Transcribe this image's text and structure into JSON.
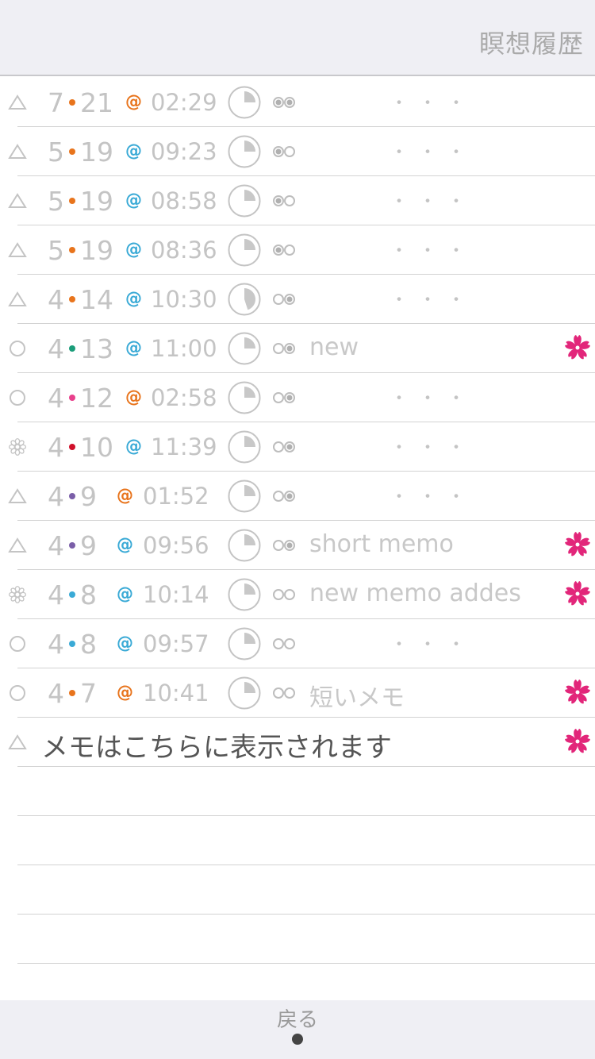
{
  "header": {
    "title": "瞑想履歴"
  },
  "colors": {
    "orange": "#e8741c",
    "blue": "#3aaad6",
    "green": "#1b9d7a",
    "pink": "#e8408c",
    "red": "#d0102a",
    "purple": "#7a5ea8",
    "flower": "#e2267a"
  },
  "records": [
    {
      "status_icon": "triangle-icon",
      "month": "7",
      "day": "21",
      "dot_color": "#e8741c",
      "at_color": "#e8741c",
      "time": "02:29",
      "progress": 0.25,
      "glasses_icon": "glasses-both-filled-icon",
      "memo": "",
      "flower": false
    },
    {
      "status_icon": "triangle-icon",
      "month": "5",
      "day": "19",
      "dot_color": "#e8741c",
      "at_color": "#3aaad6",
      "time": "09:23",
      "progress": 0.25,
      "glasses_icon": "glasses-left-filled-icon",
      "memo": "",
      "flower": false
    },
    {
      "status_icon": "triangle-icon",
      "month": "5",
      "day": "19",
      "dot_color": "#e8741c",
      "at_color": "#3aaad6",
      "time": "08:58",
      "progress": 0.25,
      "glasses_icon": "glasses-left-filled-icon",
      "memo": "",
      "flower": false
    },
    {
      "status_icon": "triangle-icon",
      "month": "5",
      "day": "19",
      "dot_color": "#e8741c",
      "at_color": "#3aaad6",
      "time": "08:36",
      "progress": 0.25,
      "glasses_icon": "glasses-left-filled-icon",
      "memo": "",
      "flower": false
    },
    {
      "status_icon": "triangle-icon",
      "month": "4",
      "day": "14",
      "dot_color": "#e8741c",
      "at_color": "#3aaad6",
      "time": "10:30",
      "progress": 0.45,
      "glasses_icon": "glasses-right-filled-icon",
      "memo": "",
      "flower": false
    },
    {
      "status_icon": "circle-icon",
      "month": "4",
      "day": "13",
      "dot_color": "#1b9d7a",
      "at_color": "#3aaad6",
      "time": "11:00",
      "progress": 0.25,
      "glasses_icon": "glasses-right-filled-icon",
      "memo": "new",
      "flower": true
    },
    {
      "status_icon": "circle-icon",
      "month": "4",
      "day": "12",
      "dot_color": "#e8408c",
      "at_color": "#e8741c",
      "time": "02:58",
      "progress": 0.25,
      "glasses_icon": "glasses-right-filled-icon",
      "memo": "",
      "flower": false
    },
    {
      "status_icon": "gear-icon",
      "month": "4",
      "day": "10",
      "dot_color": "#d0102a",
      "at_color": "#3aaad6",
      "time": "11:39",
      "progress": 0.25,
      "glasses_icon": "glasses-right-filled-icon",
      "memo": "",
      "flower": false
    },
    {
      "status_icon": "triangle-icon",
      "month": "4",
      "day": "9",
      "dot_color": "#7a5ea8",
      "at_color": "#e8741c",
      "time": "01:52",
      "progress": 0.25,
      "glasses_icon": "glasses-right-filled-icon",
      "memo": "",
      "flower": false
    },
    {
      "status_icon": "triangle-icon",
      "month": "4",
      "day": "9",
      "dot_color": "#7a5ea8",
      "at_color": "#3aaad6",
      "time": "09:56",
      "progress": 0.25,
      "glasses_icon": "glasses-right-filled-icon",
      "memo": "short memo",
      "flower": true
    },
    {
      "status_icon": "gear-icon",
      "month": "4",
      "day": "8",
      "dot_color": "#3aaad6",
      "at_color": "#3aaad6",
      "time": "10:14",
      "progress": 0.25,
      "glasses_icon": "glasses-empty-icon",
      "memo": "new memo addes",
      "flower": true
    },
    {
      "status_icon": "circle-icon",
      "month": "4",
      "day": "8",
      "dot_color": "#3aaad6",
      "at_color": "#3aaad6",
      "time": "09:57",
      "progress": 0.25,
      "glasses_icon": "glasses-empty-icon",
      "memo": "",
      "flower": false
    },
    {
      "status_icon": "circle-icon",
      "month": "4",
      "day": "7",
      "dot_color": "#e8741c",
      "at_color": "#e8741c",
      "time": "10:41",
      "progress": 0.25,
      "glasses_icon": "glasses-empty-icon",
      "memo": "短いメモ",
      "flower": true
    }
  ],
  "memo_row": {
    "status_icon": "triangle-icon",
    "text": "メモはこちらに表示されます",
    "flower": true
  },
  "ellipsis": "・・・",
  "at_symbol": "@",
  "date_separator": "•",
  "empty_rows": 4,
  "footer": {
    "back_label": "戻る"
  }
}
